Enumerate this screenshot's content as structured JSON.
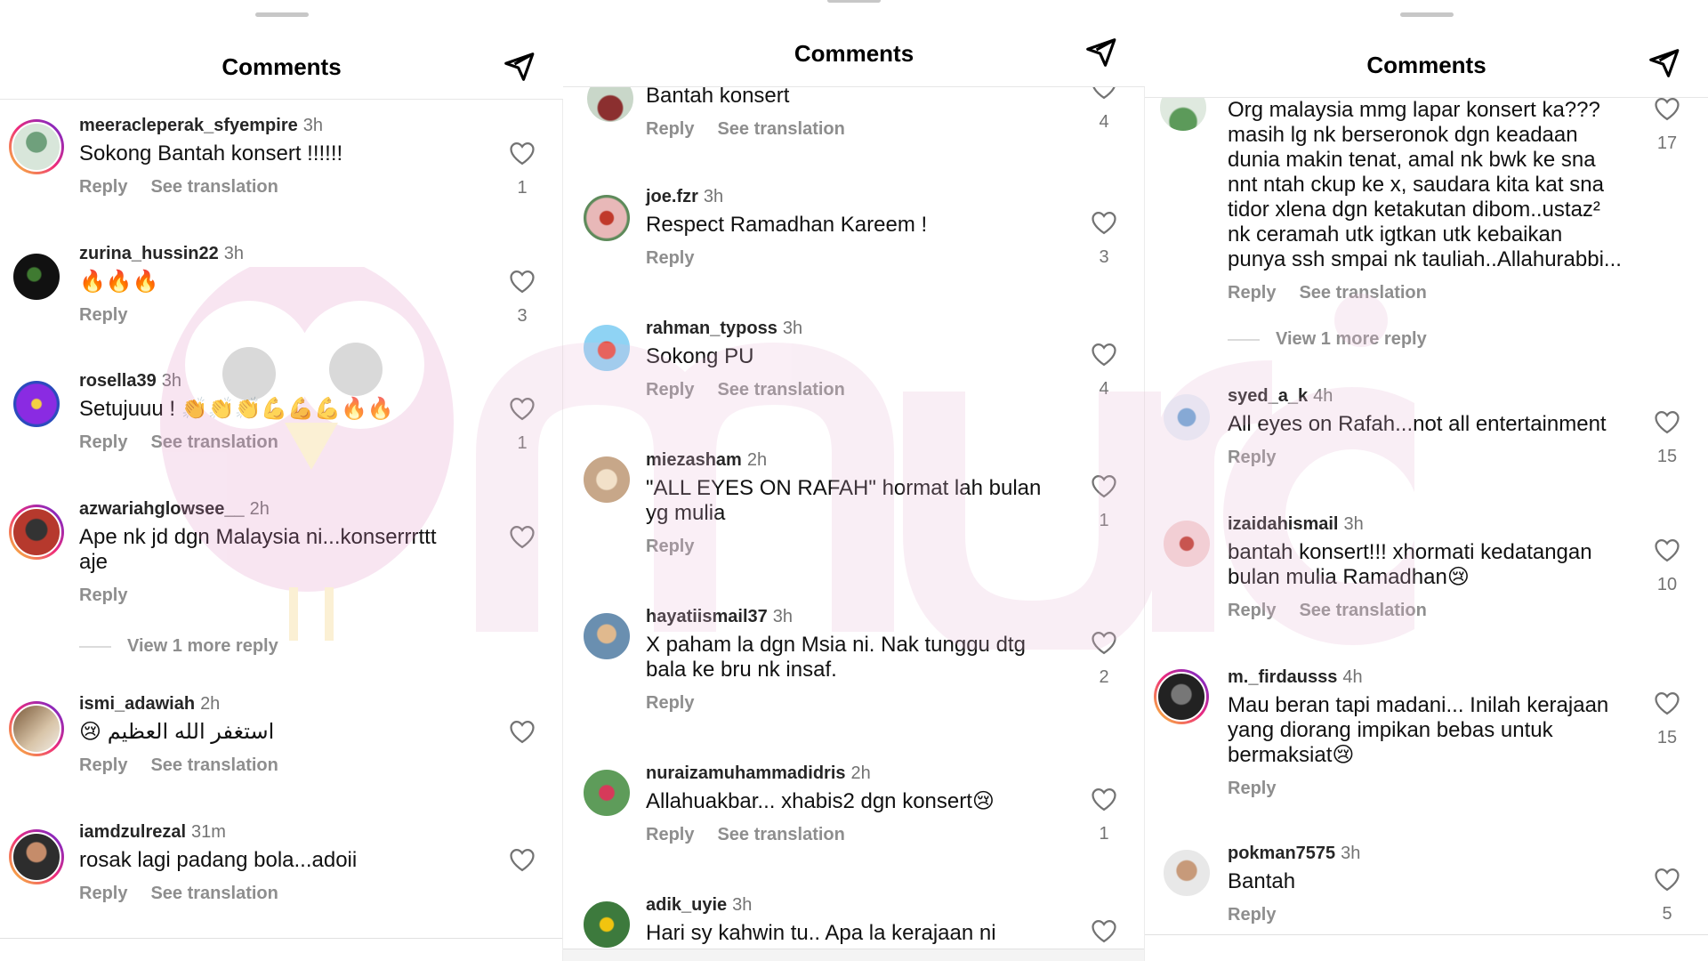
{
  "panels": [
    {
      "title": "Comments",
      "comments": [
        {
          "username": "meeracleperak_sfyempire",
          "time": "3h",
          "text": "Sokong Bantah konsert !!!!!!",
          "reply": "Reply",
          "translate": "See translation",
          "likes": "1"
        },
        {
          "username": "zurina_hussin22",
          "time": "3h",
          "text": "🔥🔥🔥",
          "reply": "Reply",
          "likes": "3"
        },
        {
          "username": "rosella39",
          "time": "3h",
          "text": "Setujuuu ! 👏👏👏💪💪💪🔥🔥",
          "reply": "Reply",
          "translate": "See translation",
          "likes": "1"
        },
        {
          "username": "azwariahglowsee__",
          "time": "2h",
          "text": "Ape nk jd dgn Malaysia ni...konserrrttt aje",
          "reply": "Reply",
          "view_more": "View 1 more reply"
        },
        {
          "username": "ismi_adawiah",
          "time": "2h",
          "text": "😢 استغفر الله العظيم",
          "reply": "Reply",
          "translate": "See translation"
        },
        {
          "username": "iamdzulrezal",
          "time": "31m",
          "text": "rosak lagi padang bola...adoii",
          "reply": "Reply",
          "translate": "See translation"
        }
      ]
    },
    {
      "title": "Comments",
      "comments": [
        {
          "username": "",
          "time": "",
          "text": "Bantah konsert",
          "reply": "Reply",
          "translate": "See translation",
          "likes": "4"
        },
        {
          "username": "joe.fzr",
          "time": "3h",
          "text": "Respect Ramadhan Kareem !",
          "reply": "Reply",
          "likes": "3"
        },
        {
          "username": "rahman_typoss",
          "time": "3h",
          "text": "Sokong PU",
          "reply": "Reply",
          "translate": "See translation",
          "likes": "4"
        },
        {
          "username": "miezasham",
          "time": "2h",
          "text": "\"ALL EYES ON RAFAH\" hormat lah bulan yg mulia",
          "reply": "Reply",
          "likes": "1"
        },
        {
          "username": "hayatiismail37",
          "time": "3h",
          "text": "X paham la dgn Msia ni. Nak tunggu dtg bala ke bru nk insaf.",
          "reply": "Reply",
          "likes": "2"
        },
        {
          "username": "nuraizamuhammadidris",
          "time": "2h",
          "text": "Allahuakbar... xhabis2 dgn konsert😢",
          "reply": "Reply",
          "translate": "See translation",
          "likes": "1"
        },
        {
          "username": "adik_uyie",
          "time": "3h",
          "text": "Hari sy kahwin tu.. Apa la kerajaan ni"
        }
      ]
    },
    {
      "title": "Comments",
      "comments": [
        {
          "username": "",
          "time": "",
          "text": "Org malaysia mmg lapar konsert ka???\nmasih lg nk berseronok dgn keadaan\ndunia makin tenat, amal nk bwk ke sna\nnnt ntah ckup ke x, saudara kita kat sna\ntidor xlena dgn ketakutan dibom..ustaz²\nnk ceramah utk igtkan utk kebaikan\npunya ssh smpai nk tauliah..Allahurabbi...",
          "reply": "Reply",
          "translate": "See translation",
          "likes": "17",
          "view_more": "View 1 more reply"
        },
        {
          "username": "syed_a_k",
          "time": "4h",
          "text": "All eyes on Rafah...not all entertainment",
          "reply": "Reply",
          "likes": "15"
        },
        {
          "username": "izaidahismail",
          "time": "3h",
          "text": "bantah konsert!!! xhormati kedatangan bulan mulia Ramadhan😢",
          "reply": "Reply",
          "translate": "See translation",
          "likes": "10"
        },
        {
          "username": "m._firdausss",
          "time": "4h",
          "text": "Mau beran tapi madani... Inilah kerajaan yang diorang impikan bebas untuk bermaksiat😢",
          "reply": "Reply",
          "likes": "15"
        },
        {
          "username": "pokman7575",
          "time": "3h",
          "text": "Bantah",
          "reply": "Reply",
          "likes": "5"
        }
      ]
    }
  ],
  "colors": {
    "ring_start": "#f9ce34",
    "ring_mid": "#ee2a7b",
    "ring_end": "#6228d7",
    "watermark": "#e8b7d4"
  },
  "icons": {
    "send": "paper-plane-icon",
    "like": "heart-outline-icon"
  }
}
